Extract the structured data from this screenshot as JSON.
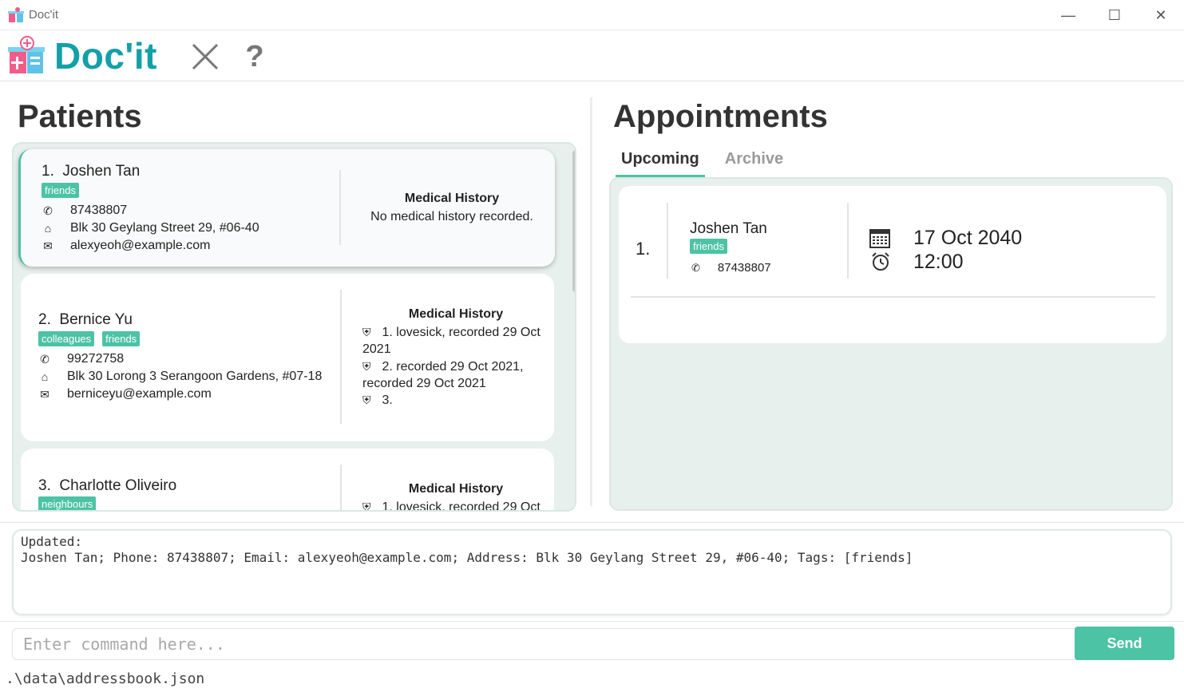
{
  "window": {
    "title": "Doc'it",
    "minimize": "—",
    "maximize": "☐",
    "close": "✕"
  },
  "header": {
    "logo_text": "Doc'it",
    "exit_icon": "✕",
    "help_icon": "?"
  },
  "patients": {
    "title": "Patients",
    "medical_history_label": "Medical History",
    "cards": [
      {
        "index": "1.",
        "name": "Joshen Tan",
        "tags": [
          "friends"
        ],
        "phone": "87438807",
        "address": "Blk 30 Geylang Street 29, #06-40",
        "email": "alexyeoh@example.com",
        "medical_history_empty": "No medical history recorded."
      },
      {
        "index": "2.",
        "name": "Bernice Yu",
        "tags": [
          "colleagues",
          "friends"
        ],
        "phone": "99272758",
        "address": "Blk 30 Lorong 3 Serangoon Gardens, #07-18",
        "email": "berniceyu@example.com",
        "medical_history": [
          "1. lovesick, recorded 29 Oct 2021",
          "2. recorded 29 Oct 2021, recorded 29 Oct 2021",
          "3."
        ]
      },
      {
        "index": "3.",
        "name": "Charlotte Oliveiro",
        "tags": [
          "neighbours"
        ],
        "medical_history": [
          "1. lovesick, recorded 29 Oct"
        ]
      }
    ]
  },
  "appointments": {
    "title": "Appointments",
    "tabs": [
      "Upcoming",
      "Archive"
    ],
    "active_tab": "Upcoming",
    "items": [
      {
        "index": "1.",
        "name": "Joshen Tan",
        "tag": "friends",
        "phone": "87438807",
        "date": "17 Oct 2040",
        "time": "12:00"
      }
    ]
  },
  "result": {
    "text": "Updated:\nJoshen Tan; Phone: 87438807; Email: alexyeoh@example.com; Address: Blk 30 Geylang Street 29, #06-40; Tags: [friends]"
  },
  "command": {
    "placeholder": "Enter command here...",
    "send_label": "Send"
  },
  "status": {
    "path": ".\\data\\addressbook.json"
  },
  "colors": {
    "accent": "#4cc3a5",
    "logo": "#13a0a8"
  }
}
